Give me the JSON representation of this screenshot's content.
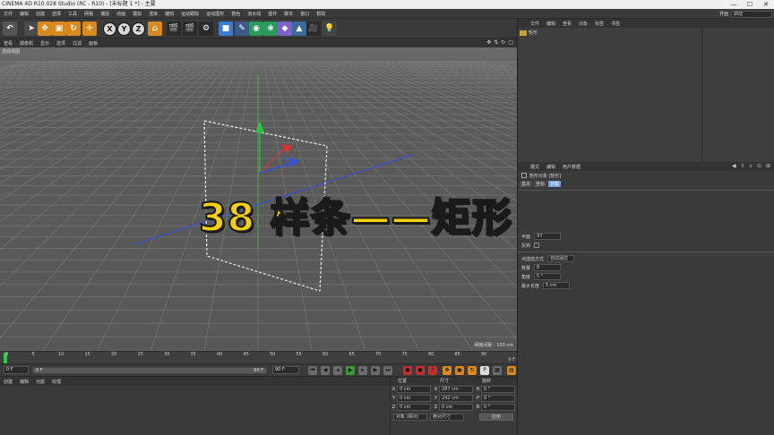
{
  "window": {
    "title": "CINEMA 4D R10.028 Studio (RC - R10) - [未标题 1 *] - 主要",
    "minimize": "—",
    "maximize": "☐",
    "close": "✕"
  },
  "menubar": {
    "items": [
      "文件",
      "编辑",
      "创建",
      "选择",
      "工具",
      "网格",
      "捕捉",
      "动画",
      "模拟",
      "渲染",
      "雕刻",
      "运动跟踪",
      "运动图形",
      "角色",
      "流水线",
      "插件",
      "脚本",
      "窗口",
      "帮助"
    ],
    "layout_label": "界面",
    "layout_value": "启动"
  },
  "toolbar": {
    "x_label": "X",
    "y_label": "Y",
    "z_label": "Z"
  },
  "viewport_menu": {
    "items": [
      "查看",
      "摄像机",
      "显示",
      "选项",
      "过滤",
      "面板"
    ],
    "view_label": "透视视图",
    "grid_label": "网格间距 : 100 cm"
  },
  "timeline": {
    "ticks": [
      "0",
      "5",
      "10",
      "15",
      "20",
      "25",
      "30",
      "35",
      "40",
      "45",
      "50",
      "55",
      "60",
      "65",
      "70",
      "75",
      "80",
      "85",
      "90"
    ],
    "frame_end_label": "0 F"
  },
  "transport": {
    "start_field": "0 F",
    "slider_start": "0 F",
    "slider_end": "90 F",
    "end_field": "90 F"
  },
  "material_panel": {
    "menu": [
      "创建",
      "编辑",
      "功能",
      "纹理"
    ]
  },
  "coord_panel": {
    "headers": [
      "位置",
      "尺寸",
      "旋转"
    ],
    "rows": [
      {
        "axis1": "X",
        "pos": "0 cm",
        "axis2": "X",
        "size": "287 cm",
        "axis3": "H",
        "rot": "0 °"
      },
      {
        "axis1": "Y",
        "pos": "0 cm",
        "axis2": "Y",
        "size": "242 cm",
        "axis3": "P",
        "rot": "0 °"
      },
      {
        "axis1": "Z",
        "pos": "0 cm",
        "axis2": "Z",
        "size": "0 cm",
        "axis3": "B",
        "rot": "0 °"
      }
    ],
    "mode_dropdown": "对象 (相对)",
    "size_dropdown": "绝对尺寸",
    "apply_label": "应用"
  },
  "object_manager": {
    "menu": [
      "文件",
      "编辑",
      "查看",
      "对象",
      "标签",
      "书签"
    ],
    "object_name": "矩形"
  },
  "attribute_manager": {
    "menu": [
      "模式",
      "编辑",
      "用户数据"
    ],
    "object_label": "矩形对象 [矩形]",
    "tabs": [
      "基本",
      "坐标",
      "对象"
    ],
    "fields": [
      {
        "label": "平面",
        "value": "XY"
      },
      {
        "label": "反转",
        "value": ""
      }
    ],
    "interp_label": "点插值方式",
    "interp_value": "自动适应",
    "interp_fields": [
      {
        "label": "数量",
        "value": "8"
      },
      {
        "label": "角度",
        "value": "5 °"
      },
      {
        "label": "最大长度",
        "value": "5 cm"
      }
    ]
  },
  "overlay": {
    "title": "38 样条——矩形"
  },
  "colors": {
    "overlay_text": "#f5d100",
    "axis_x": "#e03030",
    "axis_y": "#30c040",
    "axis_z": "#3050e0",
    "playhead": "#2ecc40"
  }
}
